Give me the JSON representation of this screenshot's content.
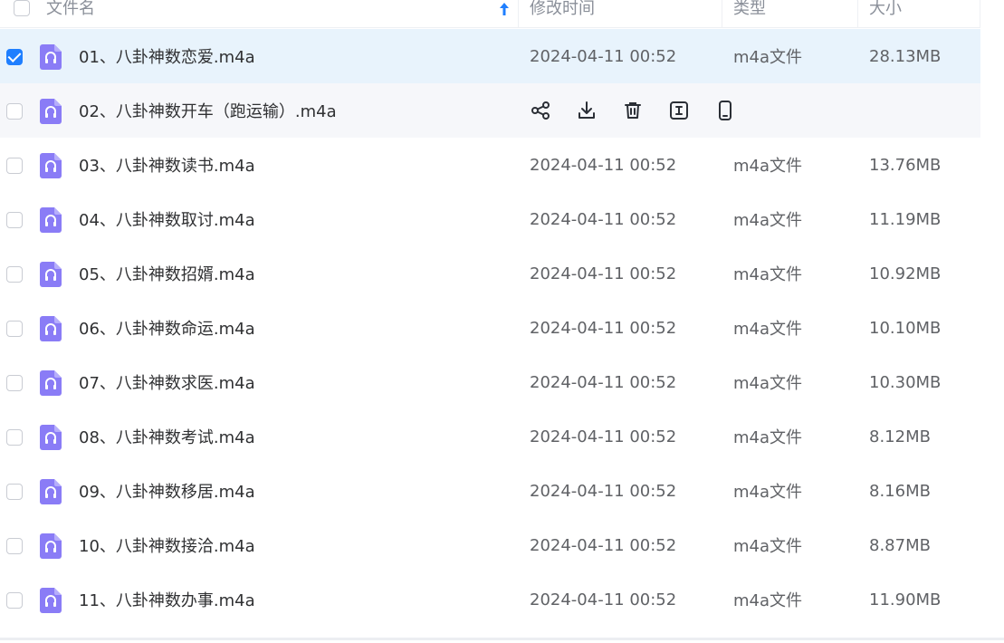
{
  "header": {
    "name_label": "文件名",
    "modified_label": "修改时间",
    "type_label": "类型",
    "size_label": "大小",
    "sort_indicator": "↑"
  },
  "colors": {
    "accent": "#1f7fff",
    "selected_row": "#e8f3fc",
    "hover_row": "#f6f7fa",
    "file_icon": "#8a7cf6"
  },
  "rows": [
    {
      "name": "01、八卦神数恋爱.m4a",
      "modified": "2024-04-11 00:52",
      "type": "m4a文件",
      "size": "28.13MB",
      "checked": true,
      "hover": false
    },
    {
      "name": "02、八卦神数开车（跑运输）.m4a",
      "modified": "",
      "type": "",
      "size": "",
      "checked": false,
      "hover": true
    },
    {
      "name": "03、八卦神数读书.m4a",
      "modified": "2024-04-11 00:52",
      "type": "m4a文件",
      "size": "13.76MB",
      "checked": false,
      "hover": false
    },
    {
      "name": "04、八卦神数取讨.m4a",
      "modified": "2024-04-11 00:52",
      "type": "m4a文件",
      "size": "11.19MB",
      "checked": false,
      "hover": false
    },
    {
      "name": "05、八卦神数招婿.m4a",
      "modified": "2024-04-11 00:52",
      "type": "m4a文件",
      "size": "10.92MB",
      "checked": false,
      "hover": false
    },
    {
      "name": "06、八卦神数命运.m4a",
      "modified": "2024-04-11 00:52",
      "type": "m4a文件",
      "size": "10.10MB",
      "checked": false,
      "hover": false
    },
    {
      "name": "07、八卦神数求医.m4a",
      "modified": "2024-04-11 00:52",
      "type": "m4a文件",
      "size": "10.30MB",
      "checked": false,
      "hover": false
    },
    {
      "name": "08、八卦神数考试.m4a",
      "modified": "2024-04-11 00:52",
      "type": "m4a文件",
      "size": "8.12MB",
      "checked": false,
      "hover": false
    },
    {
      "name": "09、八卦神数移居.m4a",
      "modified": "2024-04-11 00:52",
      "type": "m4a文件",
      "size": "8.16MB",
      "checked": false,
      "hover": false
    },
    {
      "name": "10、八卦神数接洽.m4a",
      "modified": "2024-04-11 00:52",
      "type": "m4a文件",
      "size": "8.87MB",
      "checked": false,
      "hover": false
    },
    {
      "name": "11、八卦神数办事.m4a",
      "modified": "2024-04-11 00:52",
      "type": "m4a文件",
      "size": "11.90MB",
      "checked": false,
      "hover": false
    }
  ],
  "hover_actions": [
    "share-icon",
    "download-icon",
    "delete-icon",
    "rename-icon",
    "phone-icon"
  ]
}
